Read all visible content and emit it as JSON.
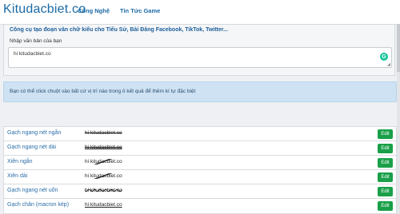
{
  "header": {
    "logo": "Kitudacbiet.co",
    "nav": [
      "Công Nghệ",
      "Tin Tức Game"
    ]
  },
  "panel": {
    "title": "Công cụ tạo đoạn văn chữ kiểu cho Tiểu Sử, Bài Đăng Facebook, TikTok, Twitter...",
    "label": "Nhập văn bản của bạn",
    "input_value": "hi kitudacbiet.co"
  },
  "info": "Bạn có thể click chuột vào bất cứ vị trí nào trong ô kết quả để thêm kí tự đặc biệt",
  "rows": [
    {
      "name": "Gạch ngang nét ngắn",
      "result": "hi kitudacbiet.co",
      "edit": "Edit"
    },
    {
      "name": "Gạch ngang nét dài",
      "result": "hi kitudacbiet.co",
      "edit": "Edit"
    },
    {
      "name": "Xiên ngắn",
      "result": "hi kitudacbiet.co",
      "edit": "Edit"
    },
    {
      "name": "Xiên dài",
      "result": "hi kitudacbiet.co",
      "edit": "Edit"
    },
    {
      "name": "Gạch ngang nét uốn",
      "result": "hi kitudacbiet.co",
      "edit": "Edit"
    },
    {
      "name": "Gạch chân (macron kép)",
      "result": "hi kitudacbiet.co",
      "edit": "Edit"
    }
  ],
  "colors": {
    "accent": "#1b6aa5",
    "edit_button": "#19a049",
    "info_bg": "#cfe2f3"
  }
}
